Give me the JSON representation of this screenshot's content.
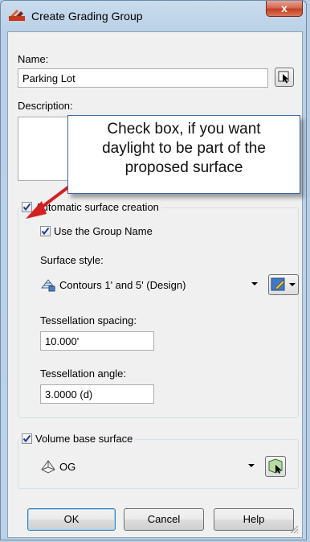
{
  "window": {
    "title": "Create Grading Group",
    "close_label": "x"
  },
  "form": {
    "name_label": "Name:",
    "name_value": "Parking Lot",
    "description_label": "Description:"
  },
  "callout": {
    "lines": [
      "Check box, if you want",
      "daylight to be part of the",
      "proposed surface"
    ]
  },
  "surface": {
    "automatic_label": "Automatic surface creation",
    "automatic_checked": true,
    "use_group_name_label": "Use the Group Name",
    "use_group_name_checked": true,
    "style_label": "Surface style:",
    "style_value": "Contours 1' and 5' (Design)",
    "tessellation_spacing_label": "Tessellation spacing:",
    "tessellation_spacing_value": "10.000'",
    "tessellation_angle_label": "Tessellation angle:",
    "tessellation_angle_value": "3.0000 (d)"
  },
  "volume": {
    "label": "Volume base surface",
    "checked": true,
    "surface_value": "OG"
  },
  "buttons": {
    "ok": "OK",
    "cancel": "Cancel",
    "help": "Help"
  },
  "colors": {
    "accent_arrow": "#d42020",
    "callout_border": "#3a66a7",
    "close_button": "#c4401f"
  }
}
